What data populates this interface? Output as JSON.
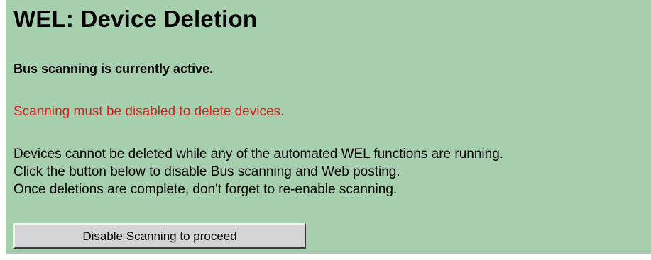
{
  "page": {
    "title": "WEL: Device Deletion",
    "status_message": "Bus scanning is currently active.",
    "warning_message": "Scanning must be disabled to delete devices.",
    "info_lines": [
      "Devices cannot be deleted while any of the automated WEL functions are running.",
      "Click the button below to disable Bus scanning and Web posting.",
      "Once deletions are complete, don't forget to re-enable scanning."
    ],
    "disable_button_label": "Disable Scanning to proceed"
  },
  "colors": {
    "panel_background": "#a5cfad",
    "warning_text": "#e51c1c",
    "button_face": "#d4d4d4"
  }
}
